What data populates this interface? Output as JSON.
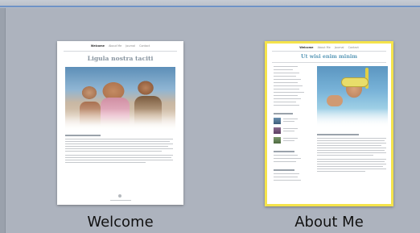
{
  "templates": [
    {
      "caption": "Welcome",
      "selected": false,
      "preview": {
        "nav": [
          "Welcome",
          "About Me",
          "Journal",
          "Contact"
        ],
        "title": "Ligula nostra taciti"
      }
    },
    {
      "caption": "About Me",
      "selected": true,
      "preview": {
        "nav": [
          "Welcome",
          "About Me",
          "Journal",
          "Contact"
        ],
        "title": "Ut wisi enim minim"
      }
    }
  ],
  "colors": {
    "selection_border": "#f4e34b",
    "background": "#aeb4bf",
    "accent_line": "#6f93c6"
  }
}
